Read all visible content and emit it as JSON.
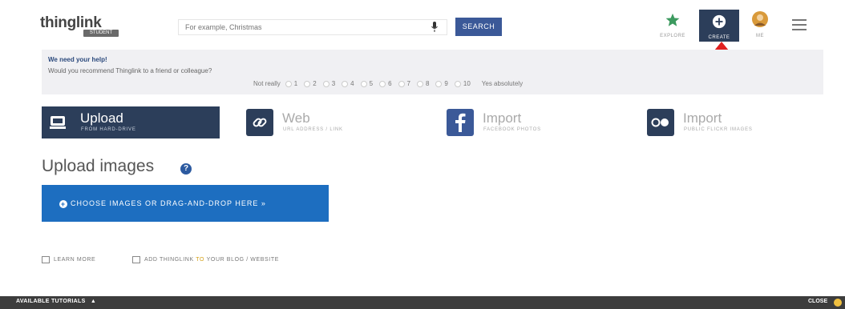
{
  "header": {
    "logo": "thinglink",
    "logo_badge": "STUDENT",
    "search_placeholder": "For example, Christmas",
    "search_button": "SEARCH",
    "nav": {
      "explore": "EXPLORE",
      "create": "CREATE",
      "me": "ME"
    }
  },
  "survey": {
    "title": "We need your help!",
    "question": "Would you recommend Thinglink to a friend or colleague?",
    "low_label": "Not really",
    "high_label": "Yes absolutely",
    "scale": [
      "1",
      "2",
      "3",
      "4",
      "5",
      "6",
      "7",
      "8",
      "9",
      "10"
    ]
  },
  "sources": [
    {
      "title": "Upload",
      "subtitle": "FROM HARD-DRIVE",
      "icon": "hard-drive-icon"
    },
    {
      "title": "Web",
      "subtitle": "URL ADDRESS / LINK",
      "icon": "link-icon"
    },
    {
      "title": "Import",
      "subtitle": "FACEBOOK PHOTOS",
      "icon": "facebook-icon"
    },
    {
      "title": "Import",
      "subtitle": "PUBLIC FLICKR IMAGES",
      "icon": "flickr-icon"
    }
  ],
  "upload": {
    "heading": "Upload images",
    "help_glyph": "?",
    "choose_button": "CHOOSE IMAGES OR DRAG-AND-DROP HERE »"
  },
  "links": {
    "learn_more": "LEARN MORE",
    "add_prefix": "ADD THINGLINK",
    "add_to": "TO",
    "add_suffix": "YOUR BLOG / WEBSITE"
  },
  "bottom_bar": {
    "tutorials": "AVAILABLE TUTORIALS",
    "close": "CLOSE"
  },
  "colors": {
    "primary_blue": "#1d6ec0",
    "dark_navy": "#2c3e5a",
    "search_blue": "#3b5998",
    "annotation_arrow": "#e02020",
    "explore_star": "#3c9a5f"
  }
}
